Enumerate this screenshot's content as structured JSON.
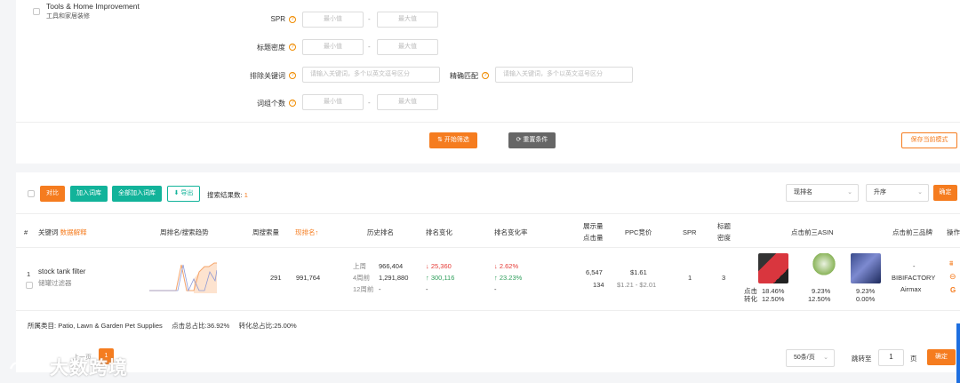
{
  "filters": {
    "category_name": "Tools & Home Improvement",
    "category_name_cn": "工具和家居装修",
    "spr_label": "SPR",
    "title_density_label": "标题密度",
    "exclude_keywords_label": "排除关键词",
    "exact_match_label": "精确匹配",
    "word_count_label": "词组个数",
    "min_placeholder": "最小值",
    "max_placeholder": "最大值",
    "keyword_placeholder": "请输入关键词，多个以英文逗号区分",
    "range_dash": "-",
    "help_glyph": "?",
    "start_button": "开始筛选",
    "reset_button": "重置条件",
    "save_mode_button": "保存当前模式"
  },
  "toolbar": {
    "compare_button": "对比",
    "add_library_button": "加入词库",
    "add_all_library_button": "全部加入词库",
    "export_button": "导出",
    "result_count_label": "搜索结果数:",
    "result_count": "1",
    "sort_field": "现排名",
    "sort_order": "升序",
    "confirm_button": "确定"
  },
  "table": {
    "headers": {
      "index": "#",
      "keyword": "关键词",
      "data_explain": "数据解释",
      "trend": "周排名/搜索趋势",
      "weekly_volume": "周搜索量",
      "current_rank": "现排名",
      "history_rank": "历史排名",
      "rank_change": "排名变化",
      "rank_change_rate": "排名变化率",
      "impressions": "展示量",
      "clicks": "点击量",
      "ppc": "PPC竞价",
      "spr": "SPR",
      "title_density_1": "标题",
      "title_density_2": "密度",
      "top3_asin": "点击前三ASIN",
      "top3_brand": "点击前三品牌",
      "action": "操作"
    },
    "row": {
      "index": "1",
      "keyword": "stock tank filter",
      "keyword_cn": "储罐过滤器",
      "weekly_volume": "291",
      "current_rank": "991,764",
      "history": [
        {
          "label": "上周",
          "value": "966,404",
          "change": "25,360",
          "rate": "2.62%"
        },
        {
          "label": "4周前",
          "value": "1,291,880",
          "change": "300,116",
          "rate": "23.23%"
        },
        {
          "label": "12周前",
          "value": "-",
          "change": "-",
          "rate": "-"
        }
      ],
      "impressions": "6,547",
      "clicks": "134",
      "ppc": "$1.61",
      "ppc_range": "$1.21 - $2.01",
      "spr": "1",
      "title_density": "3",
      "click_label": "点击",
      "conv_label": "转化",
      "asins": [
        {
          "click": "18.46%",
          "conv": "12.50%"
        },
        {
          "click": "9.23%",
          "conv": "12.50%"
        },
        {
          "click": "9.23%",
          "conv": "0.00%"
        }
      ],
      "brands": [
        "-",
        "BIBIFACTORY",
        "Airmax"
      ]
    },
    "footer": {
      "category_label": "所属类目:",
      "category": "Patio, Lawn & Garden Pet Supplies",
      "click_share_label": "点击总占比:",
      "click_share": "36.92%",
      "conv_share_label": "转化总占比:",
      "conv_share": "25.00%"
    }
  },
  "pagination": {
    "prev_label": "上一页",
    "current_page": "1",
    "page_size": "50条/页",
    "jump_label": "跳转至",
    "jump_value": "1",
    "page_unit": "页",
    "confirm_button": "确定"
  },
  "watermark": "大数跨境",
  "colors": {
    "accent": "#f57c1f",
    "teal": "#12b39a",
    "up": "#2e9e5b",
    "down": "#e53935"
  }
}
